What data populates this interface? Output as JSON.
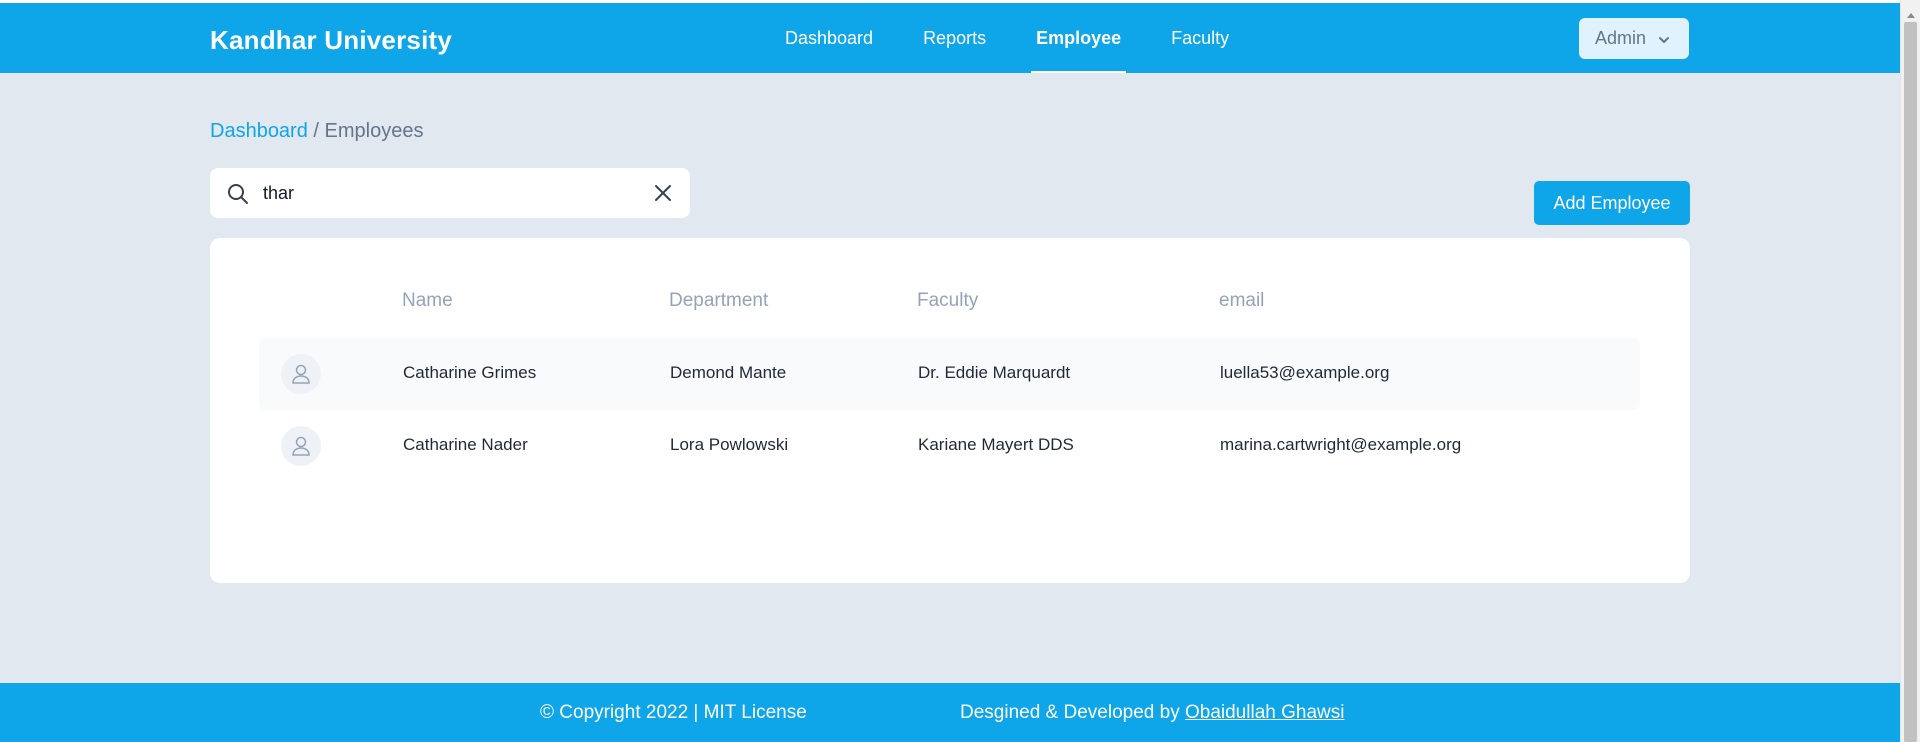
{
  "brand": "Kandhar University",
  "nav": {
    "items": [
      {
        "label": "Dashboard",
        "active": false
      },
      {
        "label": "Reports",
        "active": false
      },
      {
        "label": "Employee",
        "active": true
      },
      {
        "label": "Faculty",
        "active": false
      }
    ],
    "admin_label": "Admin"
  },
  "breadcrumb": {
    "link": "Dashboard",
    "separator": " / ",
    "current": "Employees"
  },
  "search": {
    "value": "thar",
    "placeholder": ""
  },
  "add_button": "Add Employee",
  "table": {
    "headers": [
      "Name",
      "Department",
      "Faculty",
      "email"
    ],
    "rows": [
      {
        "name": "Catharine Grimes",
        "department": "Demond Mante",
        "faculty": "Dr. Eddie Marquardt",
        "email": "luella53@example.org"
      },
      {
        "name": "Catharine Nader",
        "department": "Lora Powlowski",
        "faculty": "Kariane Mayert DDS",
        "email": "marina.cartwright@example.org"
      }
    ]
  },
  "footer": {
    "copyright": "© Copyright 2022 | MIT License",
    "credit_prefix": "Desgined & Developed by ",
    "credit_name": "Obaidullah Ghawsi"
  },
  "colors": {
    "primary": "#0ea5e9",
    "background": "#e2e8f0",
    "card": "#ffffff"
  },
  "icons": {
    "search": "search-icon",
    "clear": "close-icon",
    "chevron": "chevron-down-icon",
    "avatar": "user-icon",
    "scroll": "scroll-up-icon"
  }
}
